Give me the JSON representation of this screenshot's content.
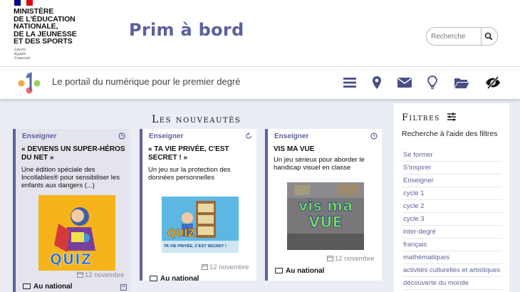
{
  "header": {
    "ministry_lines": [
      "MINISTÈRE",
      "DE L'ÉDUCATION",
      "NATIONALE,",
      "DE LA JEUNESSE",
      "ET DES SPORTS"
    ],
    "motto_lines": [
      "Liberté",
      "Égalité",
      "Fraternité"
    ],
    "site_title": "Prim à bord",
    "search": {
      "placeholder": "Recherche"
    }
  },
  "bar": {
    "tagline": "Le portail du numérique pour le premier degré",
    "icons": [
      "menu-icon",
      "location-pin-icon",
      "mail-icon",
      "lightbulb-icon",
      "folder-icon",
      "accessibility-eye-icon"
    ]
  },
  "news": {
    "heading": "Les nouveautés",
    "cards": [
      {
        "category": "Enseigner",
        "title": "« DEVIENS UN SUPER-HÉROS DU NET »",
        "description": "Une édition spéciale des Incollables® pour sensibiliser les enfants aux dangers (...)",
        "thumb_text": "QUIZ",
        "date": "12 novembre",
        "location": "Au national"
      },
      {
        "category": "Enseigner",
        "title": "« TA VIE PRIVÉE, C'EST SECRET ! »",
        "description": "Un jeu sur la protection des données personnelles",
        "thumb_text": "QUIZ",
        "thumb_caption": "TA VIE PRIVÉE, C'EST SECRET !",
        "date": "12 novembre",
        "location": "Au national"
      },
      {
        "category": "Enseigner",
        "title": "VIS MA VUE",
        "description": "Un jeu sérieux pour aborder le handicap visuel en classe",
        "thumb_text": "vis ma VUE",
        "date": "12 novembre",
        "location": "Au national"
      }
    ]
  },
  "filters": {
    "heading": "Filtres",
    "subtitle": "Recherche à l'aide des filtres",
    "items": [
      "Se former",
      "S'inspirer",
      "Enseigner",
      "cycle 1",
      "cycle 2",
      "cycle 3",
      "inter-degré",
      "français",
      "mathématiques",
      "activités culturelles et artistiques",
      "découverte du monde"
    ]
  },
  "colors": {
    "accent": "#5e6399",
    "title": "#5b5f9e",
    "page_bg": "#ebedf5",
    "quiz_yellow": "#f6b31a"
  }
}
